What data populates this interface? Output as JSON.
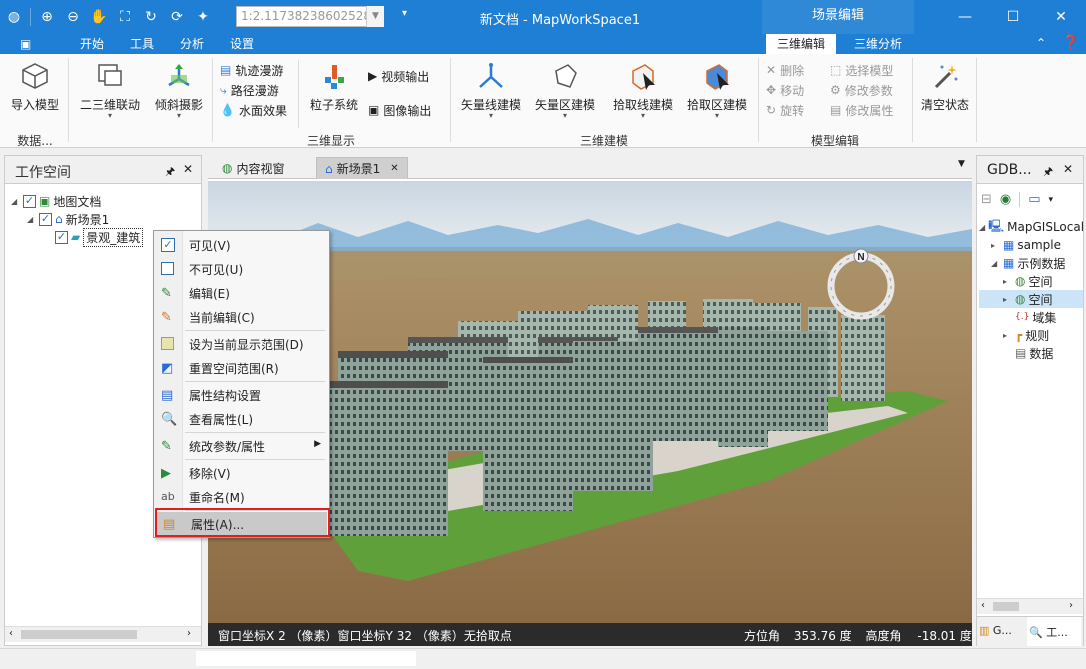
{
  "titlebar": {
    "title": "新文档 - MapWorkSpace1",
    "scale_value": "1:2.11738238602528",
    "context_tab": "场景编辑",
    "qat_icons": [
      "app-globe-icon",
      "zoom-in-icon",
      "zoom-out-icon",
      "pan-hand-icon",
      "full-extent-icon",
      "refresh-icon",
      "update-icon",
      "magic-wand-icon"
    ]
  },
  "menu": {
    "file_icon": "▣",
    "tabs": [
      "开始",
      "工具",
      "分析",
      "设置"
    ],
    "context_tabs": [
      "三维编辑",
      "三维分析"
    ]
  },
  "ribbon": {
    "import_model": "导入模型",
    "data_group": "数据...",
    "link_2d3d": "二三维联动",
    "oblique": "倾斜摄影",
    "track_roam": "轨迹漫游",
    "path_roam": "路径漫游",
    "water_effect": "水面效果",
    "display_group": "三维显示",
    "particle": "粒子系统",
    "video_out": "视频输出",
    "image_out": "图像输出",
    "vector_line_model": "矢量线建模",
    "vector_area_model": "矢量区建模",
    "pick_line_model": "拾取线建模",
    "pick_area_model": "拾取区建模",
    "build_group": "三维建模",
    "delete": "删除",
    "move": "移动",
    "rotate": "旋转",
    "select_model": "选择模型",
    "modify_params": "修改参数",
    "modify_attr": "修改属性",
    "edit_group": "模型编辑",
    "clear_state": "清空状态"
  },
  "workspace": {
    "title": "工作空间",
    "pin": "🖈",
    "close": "✕",
    "tree": {
      "root": "地图文档",
      "scene": "新场景1",
      "layer": "景观_建筑"
    }
  },
  "doc_tabs": [
    {
      "label": "内容视窗"
    },
    {
      "label": "新场景1",
      "close": "✕"
    }
  ],
  "context_menu": [
    {
      "label": "可见(V)",
      "icon": "checkbox-checked-icon",
      "checked": true
    },
    {
      "label": "不可见(U)",
      "icon": "checkbox-empty-icon"
    },
    {
      "label": "编辑(E)",
      "icon": "edit-icon"
    },
    {
      "label": "当前编辑(C)",
      "icon": "current-edit-icon",
      "sep_after": true
    },
    {
      "label": "设为当前显示范围(D)",
      "icon": "set-extent-icon"
    },
    {
      "label": "重置空间范围(R)",
      "icon": "reset-extent-icon",
      "sep_after": true
    },
    {
      "label": "属性结构设置",
      "icon": "attr-structure-icon"
    },
    {
      "label": "查看属性(L)",
      "icon": "view-attr-icon",
      "sep_after": true
    },
    {
      "label": "统改参数/属性",
      "icon": "batch-edit-icon",
      "submenu": true,
      "sep_after": true
    },
    {
      "label": "移除(V)",
      "icon": "remove-icon"
    },
    {
      "label": "重命名(M)",
      "icon": "rename-icon",
      "sep_after": true
    },
    {
      "label": "属性(A)...",
      "icon": "properties-icon",
      "highlighted": true
    }
  ],
  "scene_status": {
    "win_x_label": "窗口坐标X",
    "win_x": "2",
    "px1": "（像素）",
    "win_y_label": "窗口坐标Y",
    "win_y": "32",
    "px2": "（像素）",
    "pick": "无拾取点",
    "azimuth_label": "方位角",
    "azimuth": "353.76",
    "deg1": "度",
    "pitch_label": "高度角",
    "pitch": "-18.01",
    "deg2": "度"
  },
  "compass": {
    "north": "N"
  },
  "gdb": {
    "title": "GDB...",
    "pin": "🖈",
    "close": "✕",
    "tree": [
      "MapGISLocal",
      "sample",
      "示例数据",
      "空间",
      "空间",
      "域集",
      "规则",
      "数据"
    ],
    "bottom_tabs": [
      "G...",
      "工..."
    ]
  },
  "colors": {
    "titlebar": "#1e7fd4",
    "context_tab": "#2f89d6",
    "highlight_border": "#e02020",
    "grass": "#5fa03a",
    "ground": "#a8865b"
  }
}
